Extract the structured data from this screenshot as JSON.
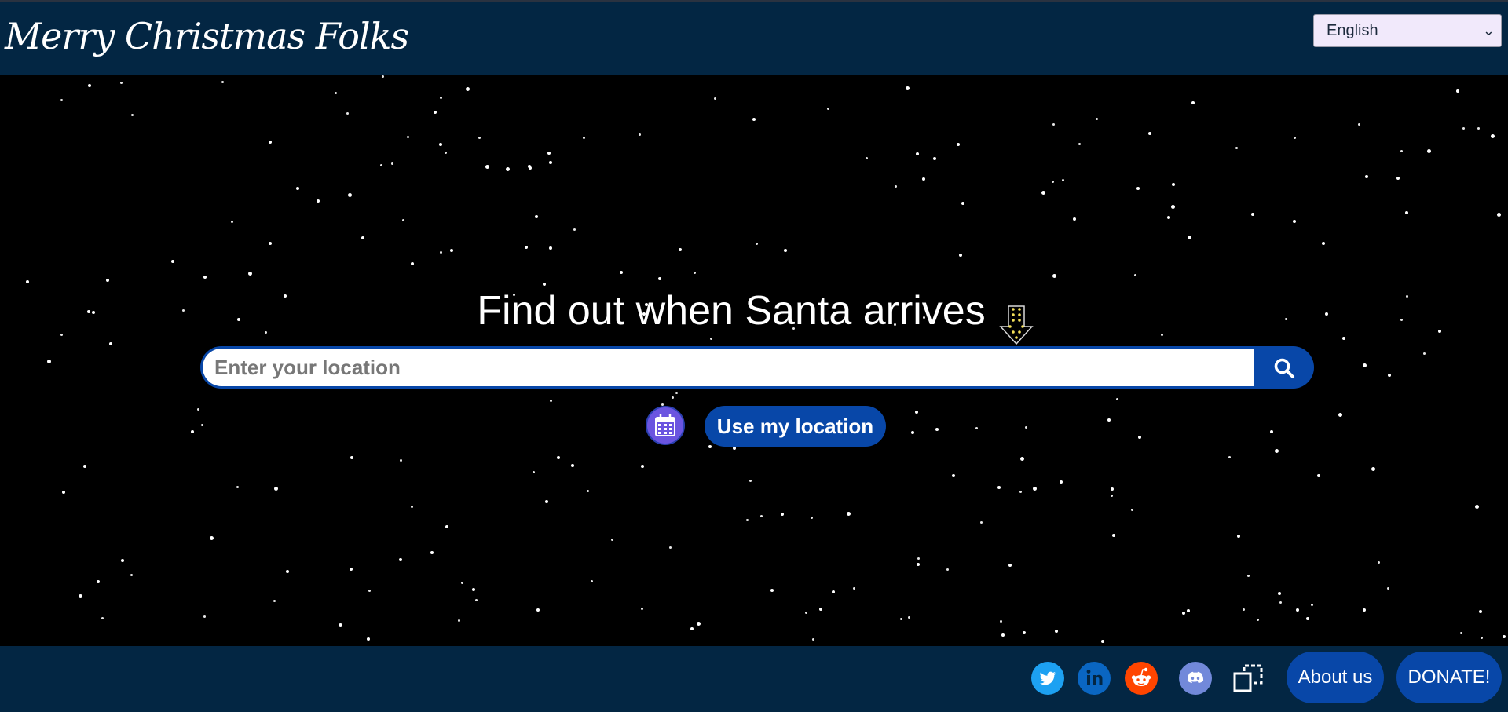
{
  "header": {
    "brand": "Merry Christmas Folks",
    "language": {
      "selected": "English"
    }
  },
  "main": {
    "headline": "Find out when Santa arrives",
    "search": {
      "placeholder": "Enter your location",
      "value": ""
    },
    "location_button": "Use my location"
  },
  "footer": {
    "about_label": "About us",
    "donate_label": "DONATE!"
  },
  "icons": {
    "search": "search-icon",
    "calendar": "calendar-icon",
    "twitter": "twitter-icon",
    "linkedin": "linkedin-icon",
    "reddit": "reddit-icon",
    "discord": "discord-icon",
    "embed": "copy-embed-icon",
    "arrow": "dotted-down-arrow-icon"
  },
  "colors": {
    "topbar": "#032643",
    "accent": "#0847a8",
    "sky": "#000000",
    "calendar": "#6b55e0",
    "twitter": "#1da1f2",
    "linkedin": "#0a66c2",
    "reddit": "#ff4500",
    "discord": "#7289da"
  }
}
